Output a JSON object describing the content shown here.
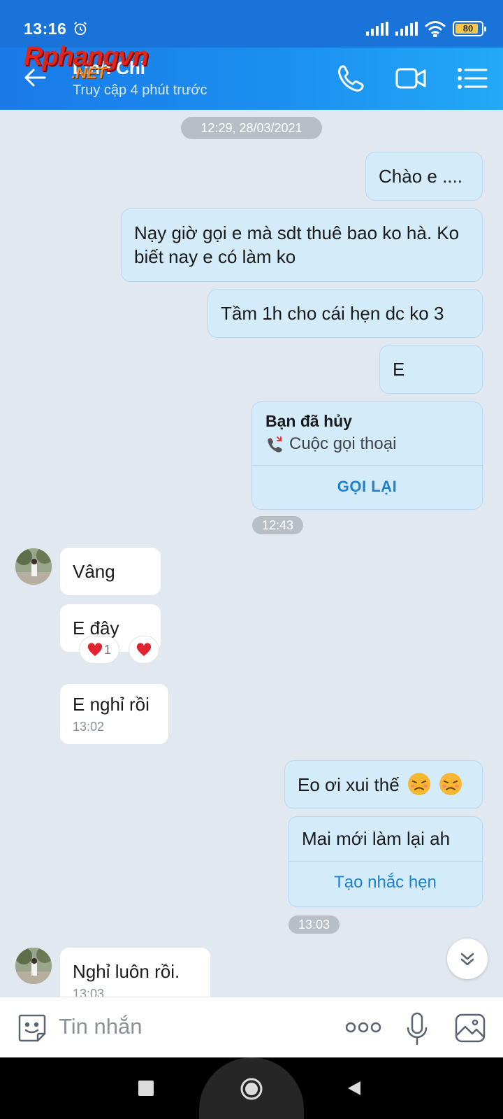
{
  "status_bar": {
    "time": "13:16",
    "battery": "80"
  },
  "header": {
    "contact_name": "Linh Chi",
    "last_seen": "Truy cập 4 phút trước",
    "watermark_line1": "Rphangvn",
    "watermark_line2": ".NET"
  },
  "chat": {
    "date_separator": "12:29, 28/03/2021",
    "sent_1": "Chào e ....",
    "sent_2": "Nạy giờ gọi e mà sdt thuê bao ko hà. Ko biết nay e có làm ko",
    "sent_3": "Tầm 1h cho cái hẹn dc ko 3",
    "sent_4": "E",
    "call_card": {
      "title": "Bạn đã hủy",
      "subtitle": "Cuộc gọi thoại",
      "action": "GỌI LẠI"
    },
    "time_1": "12:43",
    "recv_1": "Vâng",
    "recv_2": "E đây",
    "reaction_count": "1",
    "recv_3": "E nghỉ rồi",
    "recv_3_time": "13:02",
    "sent_5": "Eo ơi xui thế",
    "remind_card": {
      "text": "Mai mới làm lại ah",
      "action": "Tạo nhắc hẹn"
    },
    "time_2": "13:03",
    "recv_4": "Nghỉ luôn rồi.",
    "recv_4_time": "13:03"
  },
  "composer": {
    "placeholder": "Tin nhắn"
  },
  "colors": {
    "header_start": "#1a7ae8",
    "header_end": "#22a9f7",
    "sent_bubble": "#d4ecfa",
    "received_bubble": "#ffffff",
    "link": "#1f7fd0",
    "chat_bg": "#e2e8ef"
  }
}
